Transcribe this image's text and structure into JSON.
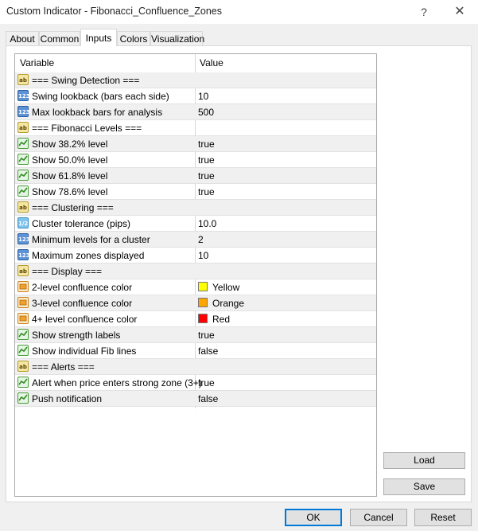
{
  "window": {
    "title": "Custom Indicator - Fibonacci_Confluence_Zones",
    "help": "?",
    "close": "✕"
  },
  "tabs": [
    {
      "label": "About"
    },
    {
      "label": "Common"
    },
    {
      "label": "Inputs"
    },
    {
      "label": "Colors"
    },
    {
      "label": "Visualization"
    }
  ],
  "active_tab": "Inputs",
  "grid": {
    "headers": {
      "variable": "Variable",
      "value": "Value"
    },
    "rows": [
      {
        "type": "ab",
        "variable": "=== Swing Detection ===",
        "value": ""
      },
      {
        "type": "int",
        "variable": "Swing lookback (bars each side)",
        "value": "10"
      },
      {
        "type": "int",
        "variable": "Max lookback bars for analysis",
        "value": "500"
      },
      {
        "type": "ab",
        "variable": "=== Fibonacci Levels ===",
        "value": ""
      },
      {
        "type": "bool",
        "variable": "Show 38.2% level",
        "value": "true"
      },
      {
        "type": "bool",
        "variable": "Show 50.0% level",
        "value": "true"
      },
      {
        "type": "bool",
        "variable": "Show 61.8% level",
        "value": "true"
      },
      {
        "type": "bool",
        "variable": "Show 78.6% level",
        "value": "true"
      },
      {
        "type": "ab",
        "variable": "=== Clustering ===",
        "value": ""
      },
      {
        "type": "dbl",
        "variable": "Cluster tolerance (pips)",
        "value": "10.0"
      },
      {
        "type": "int",
        "variable": "Minimum levels for a cluster",
        "value": "2"
      },
      {
        "type": "int",
        "variable": "Maximum zones displayed",
        "value": "10"
      },
      {
        "type": "ab",
        "variable": "=== Display ===",
        "value": ""
      },
      {
        "type": "color",
        "variable": "2-level confluence color",
        "value": "Yellow",
        "swatch": "#ffff00"
      },
      {
        "type": "color",
        "variable": "3-level confluence color",
        "value": "Orange",
        "swatch": "#ffa500"
      },
      {
        "type": "color",
        "variable": "4+ level confluence color",
        "value": "Red",
        "swatch": "#ff0000"
      },
      {
        "type": "bool",
        "variable": "Show strength labels",
        "value": "true"
      },
      {
        "type": "bool",
        "variable": "Show individual Fib lines",
        "value": "false"
      },
      {
        "type": "ab",
        "variable": "=== Alerts ===",
        "value": ""
      },
      {
        "type": "bool",
        "variable": "Alert when price enters strong zone (3+)",
        "value": "true"
      },
      {
        "type": "bool",
        "variable": "Push notification",
        "value": "false"
      }
    ]
  },
  "buttons": {
    "load": "Load",
    "save": "Save",
    "ok": "OK",
    "cancel": "Cancel",
    "reset": "Reset"
  },
  "icon_labels": {
    "ab": "ab",
    "int": "123",
    "dbl": "1/2"
  },
  "colors": {
    "accent": "#0078d7",
    "dialog_bg": "#f0f0f0",
    "row_alt": "#f0f0f0"
  }
}
